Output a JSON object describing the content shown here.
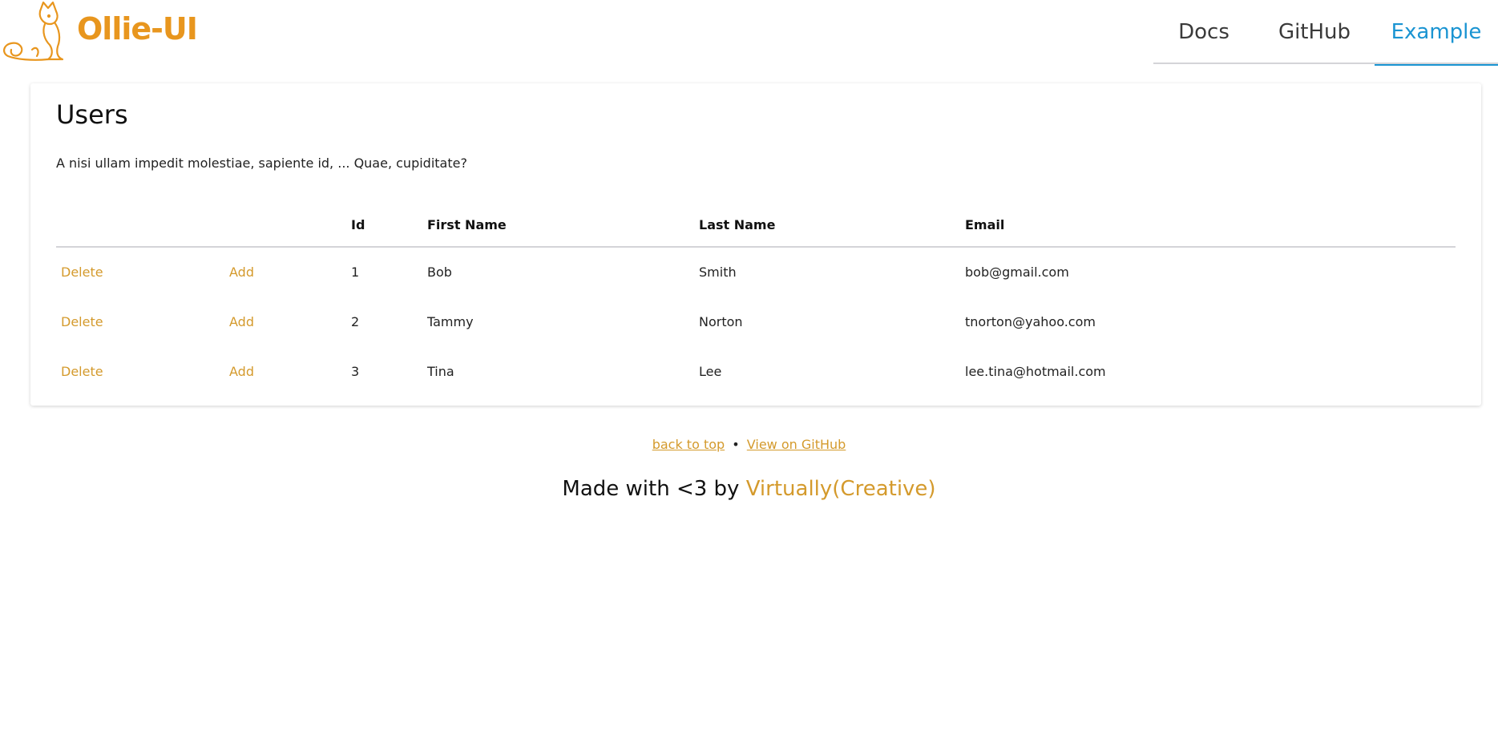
{
  "header": {
    "logo_text": "Ollie-UI",
    "logo_icon": "cat-icon",
    "brand_color": "#e8961e",
    "nav": [
      {
        "label": "Docs"
      },
      {
        "label": "GitHub"
      },
      {
        "label": "Example",
        "active": true
      }
    ],
    "active_color": "#1a94d2"
  },
  "card": {
    "title": "Users",
    "description": "A nisi ullam impedit molestiae, sapiente id, ... Quae, cupiditate?",
    "table": {
      "headers": [
        "",
        "",
        "Id",
        "First Name",
        "Last Name",
        "Email"
      ],
      "rows": [
        {
          "delete": "Delete",
          "add": "Add",
          "id": "1",
          "first": "Bob",
          "last": "Smith",
          "email": "bob@gmail.com"
        },
        {
          "delete": "Delete",
          "add": "Add",
          "id": "2",
          "first": "Tammy",
          "last": "Norton",
          "email": "tnorton@yahoo.com"
        },
        {
          "delete": "Delete",
          "add": "Add",
          "id": "3",
          "first": "Tina",
          "last": "Lee",
          "email": "lee.tina@hotmail.com"
        }
      ]
    },
    "link_color": "#d49a2c"
  },
  "footer": {
    "back_to_top": "back to top",
    "separator": "•",
    "view_github": "View on GitHub",
    "made_with": "Made with <3 by ",
    "author": "Virtually(Creative)"
  }
}
